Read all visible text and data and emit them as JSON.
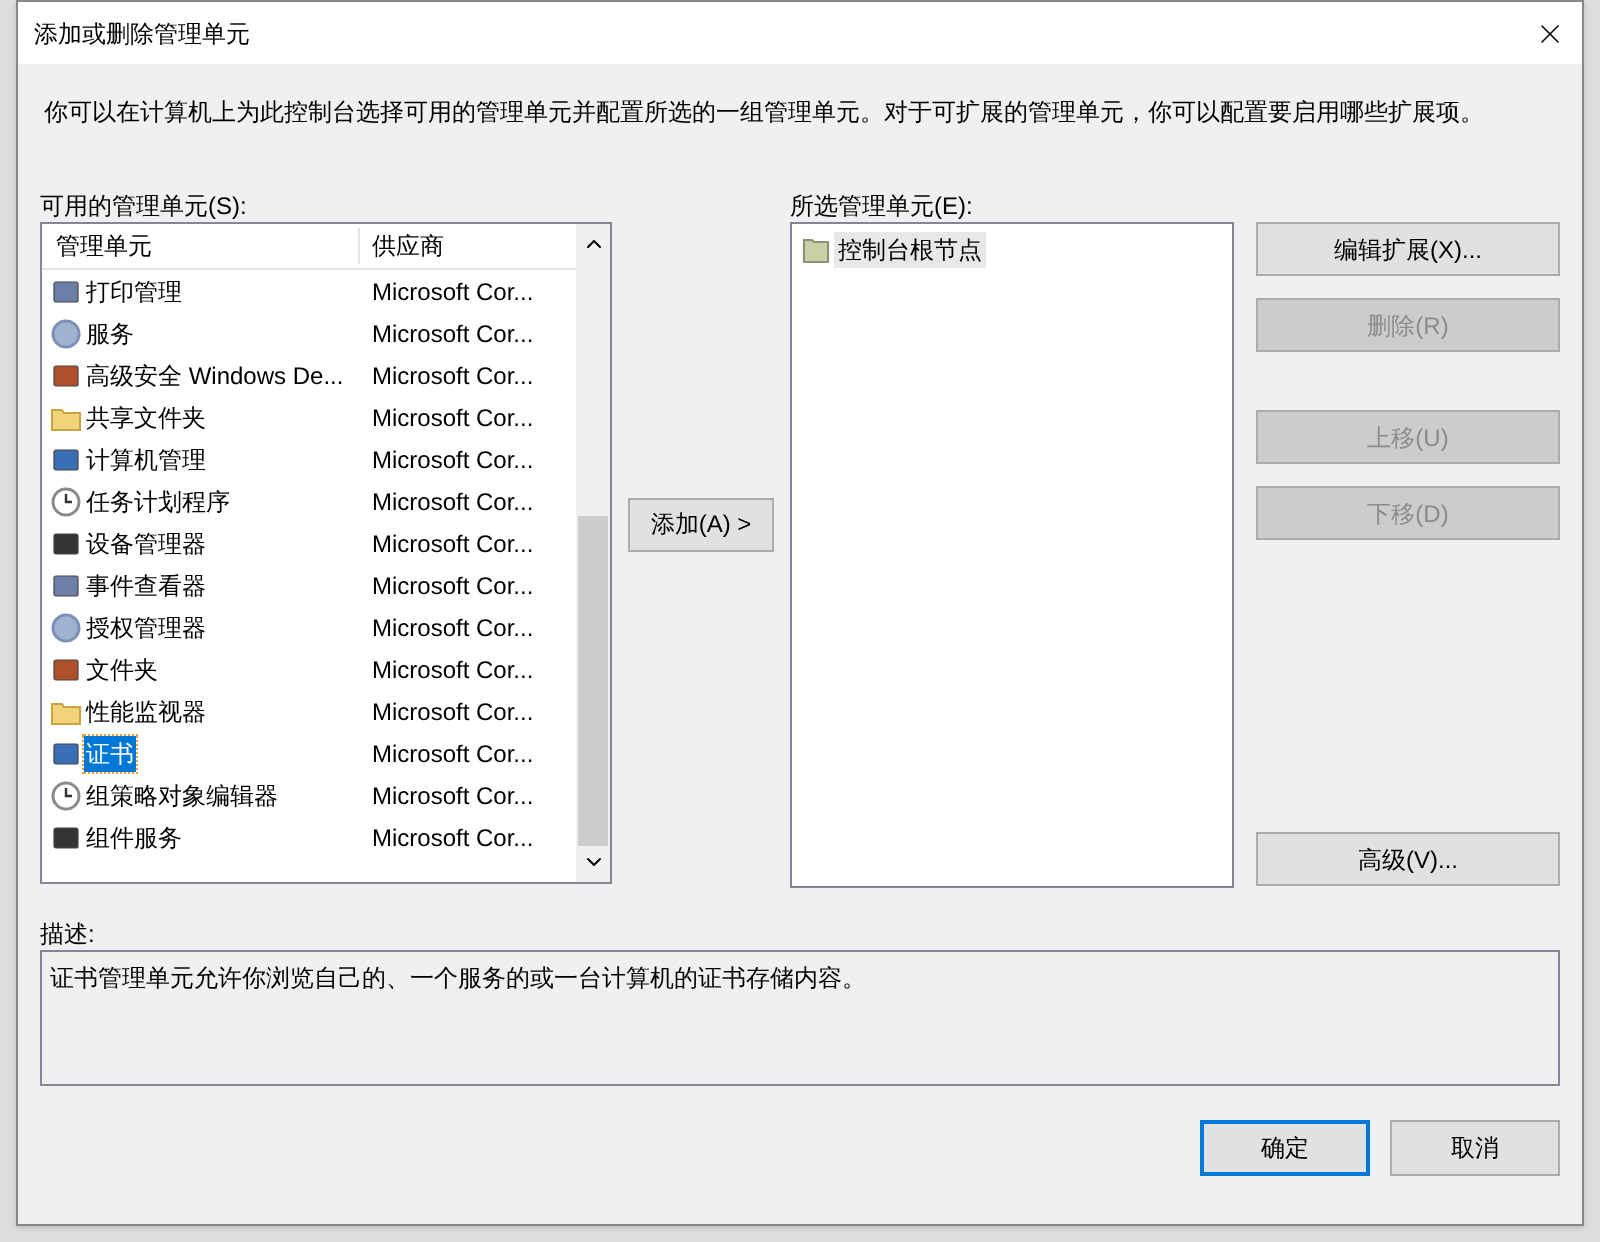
{
  "window": {
    "title": "添加或删除管理单元"
  },
  "intro": "你可以在计算机上为此控制台选择可用的管理单元并配置所选的一组管理单元。对于可扩展的管理单元，你可以配置要启用哪些扩展项。",
  "available": {
    "label": "可用的管理单元(S):",
    "columns": [
      "管理单元",
      "供应商"
    ],
    "rows": [
      {
        "name": "打印管理",
        "vendor": "Microsoft Cor...",
        "selected": false
      },
      {
        "name": "服务",
        "vendor": "Microsoft Cor...",
        "selected": false
      },
      {
        "name": "高级安全 Windows De...",
        "vendor": "Microsoft Cor...",
        "selected": false
      },
      {
        "name": "共享文件夹",
        "vendor": "Microsoft Cor...",
        "selected": false
      },
      {
        "name": "计算机管理",
        "vendor": "Microsoft Cor...",
        "selected": false
      },
      {
        "name": "任务计划程序",
        "vendor": "Microsoft Cor...",
        "selected": false
      },
      {
        "name": "设备管理器",
        "vendor": "Microsoft Cor...",
        "selected": false
      },
      {
        "name": "事件查看器",
        "vendor": "Microsoft Cor...",
        "selected": false
      },
      {
        "name": "授权管理器",
        "vendor": "Microsoft Cor...",
        "selected": false
      },
      {
        "name": "文件夹",
        "vendor": "Microsoft Cor...",
        "selected": false
      },
      {
        "name": "性能监视器",
        "vendor": "Microsoft Cor...",
        "selected": false
      },
      {
        "name": "证书",
        "vendor": "Microsoft Cor...",
        "selected": true
      },
      {
        "name": "组策略对象编辑器",
        "vendor": "Microsoft Cor...",
        "selected": false
      },
      {
        "name": "组件服务",
        "vendor": "Microsoft Cor...",
        "selected": false
      }
    ]
  },
  "add_button": {
    "label": "添加(A) >",
    "disabled": false
  },
  "selected_list": {
    "label": "所选管理单元(E):",
    "items": [
      {
        "name": "控制台根节点",
        "selected": true
      }
    ]
  },
  "edit_buttons": [
    {
      "label": "编辑扩展(X)...",
      "disabled": false
    },
    {
      "label": "删除(R)",
      "disabled": true
    }
  ],
  "move_buttons": [
    {
      "label": "上移(U)",
      "disabled": true
    },
    {
      "label": "下移(D)",
      "disabled": true
    }
  ],
  "advanced_button": {
    "label": "高级(V)...",
    "disabled": false
  },
  "description": {
    "label": "描述:",
    "text": "证书管理单元允许你浏览自己的、一个服务的或一台计算机的证书存储内容。"
  },
  "footer_buttons": [
    {
      "label": "确定",
      "default": true
    },
    {
      "label": "取消",
      "default": false
    }
  ]
}
